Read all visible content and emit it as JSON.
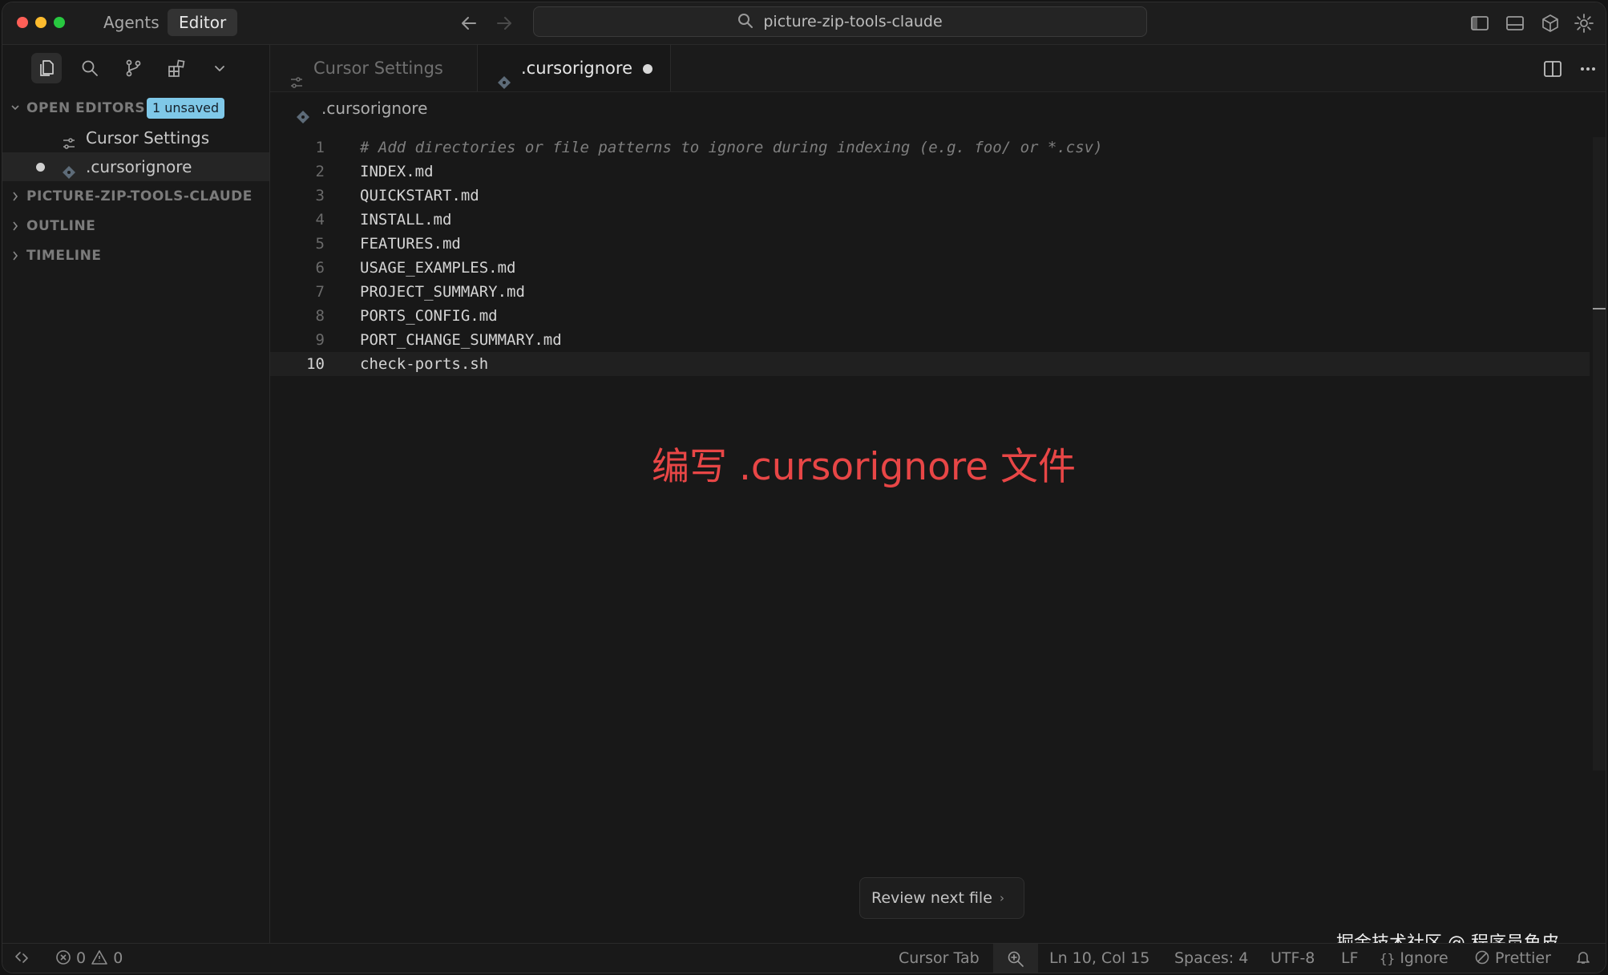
{
  "titlebar": {
    "modes": [
      "Agents",
      "Editor"
    ],
    "active_mode": "Editor",
    "search_text": "picture-zip-tools-claude"
  },
  "sidebar": {
    "open_editors": {
      "label": "OPEN EDITORS",
      "badge": "1 unsaved",
      "items": [
        {
          "label": "Cursor Settings",
          "icon": "settings-sliders-icon",
          "modified": false
        },
        {
          "label": ".cursorignore",
          "icon": "git-diamond-icon",
          "modified": true
        }
      ]
    },
    "sections": [
      "PICTURE-ZIP-TOOLS-CLAUDE",
      "OUTLINE",
      "TIMELINE"
    ]
  },
  "tabs": [
    {
      "label": "Cursor Settings",
      "active": false
    },
    {
      "label": ".cursorignore",
      "active": true,
      "modified": true
    }
  ],
  "breadcrumb": ".cursorignore",
  "editor": {
    "current_line": 10,
    "lines": [
      {
        "n": "1",
        "text": "# Add directories or file patterns to ignore during indexing (e.g. foo/ or *.csv)",
        "comment": true
      },
      {
        "n": "2",
        "text": "INDEX.md"
      },
      {
        "n": "3",
        "text": "QUICKSTART.md"
      },
      {
        "n": "4",
        "text": "INSTALL.md"
      },
      {
        "n": "5",
        "text": "FEATURES.md"
      },
      {
        "n": "6",
        "text": "USAGE_EXAMPLES.md"
      },
      {
        "n": "7",
        "text": "PROJECT_SUMMARY.md"
      },
      {
        "n": "8",
        "text": "PORTS_CONFIG.md"
      },
      {
        "n": "9",
        "text": "PORT_CHANGE_SUMMARY.md"
      },
      {
        "n": "10",
        "text": "check-ports.sh"
      }
    ]
  },
  "annotation": "编写 .cursorignore 文件",
  "review_button": "Review next file",
  "watermark": "掘金技术社区 @ 程序员鱼皮",
  "statusbar": {
    "errors": "0",
    "warnings": "0",
    "cursor_tab": "Cursor Tab",
    "position": "Ln 10, Col 15",
    "spaces": "Spaces: 4",
    "encoding": "UTF-8",
    "eol": "LF",
    "language": "Ignore",
    "formatter": "Prettier"
  },
  "colors": {
    "annotation": "#e84646",
    "badge": "#7fc8e8",
    "traffic_red": "#ff5f57",
    "traffic_yellow": "#febc2e",
    "traffic_green": "#28c840"
  }
}
